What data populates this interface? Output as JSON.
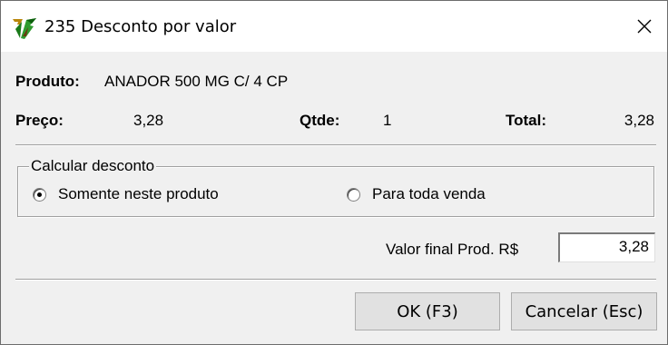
{
  "window": {
    "title": "235 Desconto por valor",
    "icon": "app-logo-icon",
    "close_icon": "close-icon"
  },
  "product": {
    "label": "Produto:",
    "name": "ANADOR 500 MG C/ 4 CP"
  },
  "summary": {
    "price_label": "Preço:",
    "price_value": "3,28",
    "qty_label": "Qtde:",
    "qty_value": "1",
    "total_label": "Total:",
    "total_value": "3,28"
  },
  "discount_group": {
    "legend": "Calcular desconto",
    "options": [
      {
        "label": "Somente neste produto",
        "selected": true
      },
      {
        "label": "Para toda venda",
        "selected": false
      }
    ]
  },
  "final_value": {
    "label": "Valor final Prod. R$",
    "value": "3,28"
  },
  "buttons": {
    "ok": "OK (F3)",
    "cancel": "Cancelar (Esc)"
  }
}
